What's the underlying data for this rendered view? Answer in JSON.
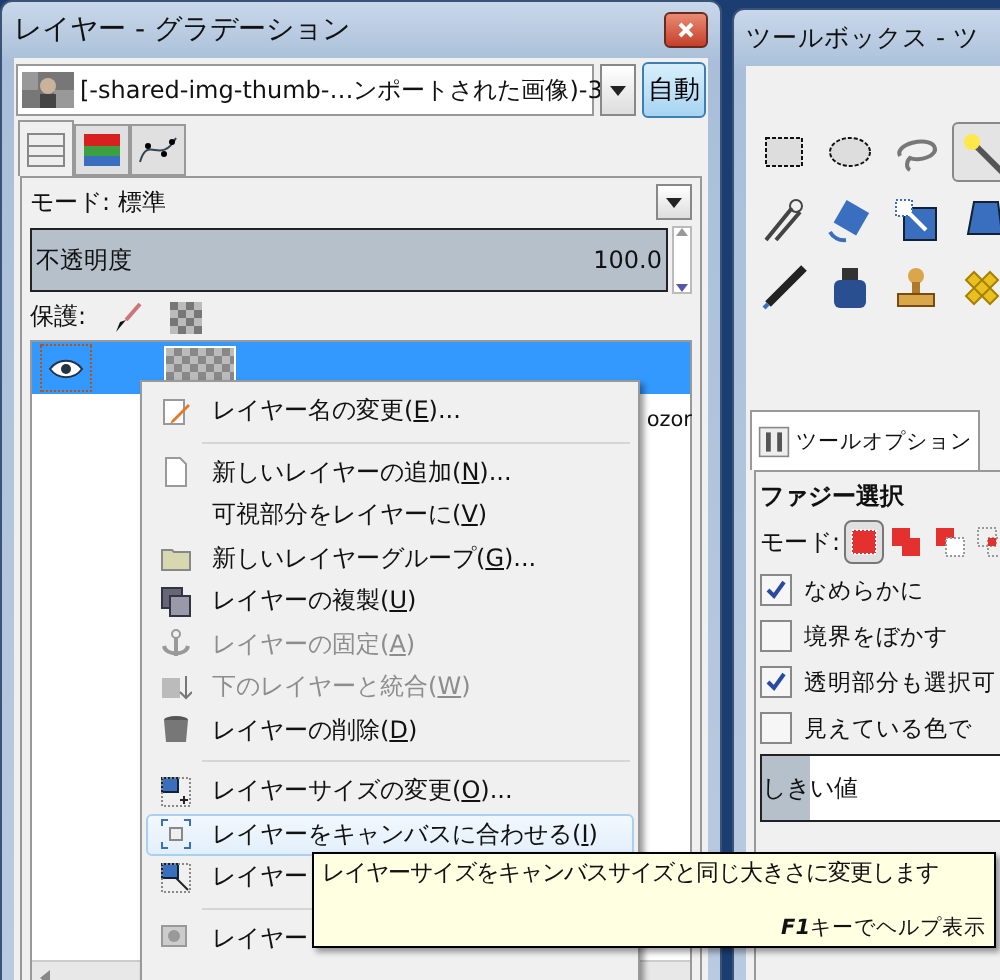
{
  "layers_window": {
    "title": "レイヤー - グラデーション",
    "image_combo": {
      "value": "[-shared-img-thumb-…ンポートされた画像)-3"
    },
    "auto_button": "自動",
    "tabs": [
      {
        "kind": "layers",
        "selected": true
      },
      {
        "kind": "channels",
        "selected": false
      },
      {
        "kind": "paths",
        "selected": false
      }
    ],
    "mode": {
      "label": "モード:",
      "value": "標準"
    },
    "opacity": {
      "label": "不透明度",
      "value": "100.0",
      "level": 1
    },
    "lock": {
      "label": "保護:"
    },
    "layers": [
      {
        "visible": true,
        "selected": true
      },
      {
        "name": "ozor",
        "visible": false,
        "selected": false
      }
    ]
  },
  "context_menu": {
    "items": [
      {
        "kind": "rename",
        "label": "レイヤー名の変更(",
        "mnemonic": "E",
        "end": ")...",
        "disabled": false,
        "highlighted": false
      },
      {
        "kind": "separator"
      },
      {
        "kind": "new",
        "label": "新しいレイヤーの追加(",
        "mnemonic": "N",
        "end": ")...",
        "disabled": false,
        "highlighted": false
      },
      {
        "kind": "plain",
        "label": "可視部分をレイヤーに(",
        "mnemonic": "V",
        "end": ")",
        "disabled": false,
        "highlighted": false
      },
      {
        "kind": "group",
        "label": "新しいレイヤーグループ(",
        "mnemonic": "G",
        "end": ")...",
        "disabled": false,
        "highlighted": false
      },
      {
        "kind": "duplicate",
        "label": "レイヤーの複製(",
        "mnemonic": "U",
        "end": ")",
        "disabled": false,
        "highlighted": false
      },
      {
        "kind": "anchor",
        "label": "レイヤーの固定(",
        "mnemonic": "A",
        "end": ")",
        "disabled": true,
        "highlighted": false
      },
      {
        "kind": "merge",
        "label": "下のレイヤーと統合(",
        "mnemonic": "W",
        "end": ")",
        "disabled": true,
        "highlighted": false
      },
      {
        "kind": "delete",
        "label": "レイヤーの削除(",
        "mnemonic": "D",
        "end": ")",
        "disabled": false,
        "highlighted": false
      },
      {
        "kind": "separator"
      },
      {
        "kind": "resize",
        "label": "レイヤーサイズの変更(",
        "mnemonic": "O",
        "end": ")...",
        "disabled": false,
        "highlighted": false
      },
      {
        "kind": "fit",
        "label": "レイヤーをキャンバスに合わせる(",
        "mnemonic": "I",
        "end": ")",
        "disabled": false,
        "highlighted": true
      },
      {
        "kind": "scale",
        "label": "レイヤー",
        "disabled": false,
        "highlighted": false
      },
      {
        "kind": "separator"
      },
      {
        "kind": "mask",
        "label": "レイヤー",
        "disabled": false,
        "highlighted": false
      }
    ]
  },
  "tooltip": {
    "text": "レイヤーサイズをキャンバスサイズと同じ大きさに変更します",
    "key": "F1",
    "hint": "キーでヘルプ表示"
  },
  "toolbox": {
    "title": "ツールボックス - ツ",
    "tools": [
      {
        "kind": "rect-select",
        "selected": false
      },
      {
        "kind": "ellipse-select",
        "selected": false
      },
      {
        "kind": "lasso",
        "selected": false
      },
      {
        "kind": "wand",
        "selected": true
      },
      {
        "kind": "scissors",
        "selected": false
      },
      {
        "kind": "rotate",
        "selected": false
      },
      {
        "kind": "scale",
        "selected": false
      },
      {
        "kind": "perspective",
        "selected": false
      },
      {
        "kind": "pen",
        "selected": false
      },
      {
        "kind": "ink",
        "selected": false
      },
      {
        "kind": "stamp",
        "selected": false
      },
      {
        "kind": "heal",
        "selected": false
      }
    ],
    "options_tab": "ツールオプション",
    "options_title": "ファジー選択",
    "mode_label": "モード:",
    "modes": [
      {
        "kind": "replace",
        "selected": true
      },
      {
        "kind": "add",
        "selected": false
      },
      {
        "kind": "subtract",
        "selected": false
      },
      {
        "kind": "intersect",
        "selected": false
      }
    ],
    "options": [
      {
        "label": "なめらかに",
        "checked": true
      },
      {
        "label": "境界をぼかす",
        "checked": false
      },
      {
        "label": "透明部分も選択可",
        "checked": true
      },
      {
        "label": "見えている色で",
        "checked": false
      }
    ],
    "threshold": {
      "label": "しきい値",
      "level": 0.18
    }
  }
}
